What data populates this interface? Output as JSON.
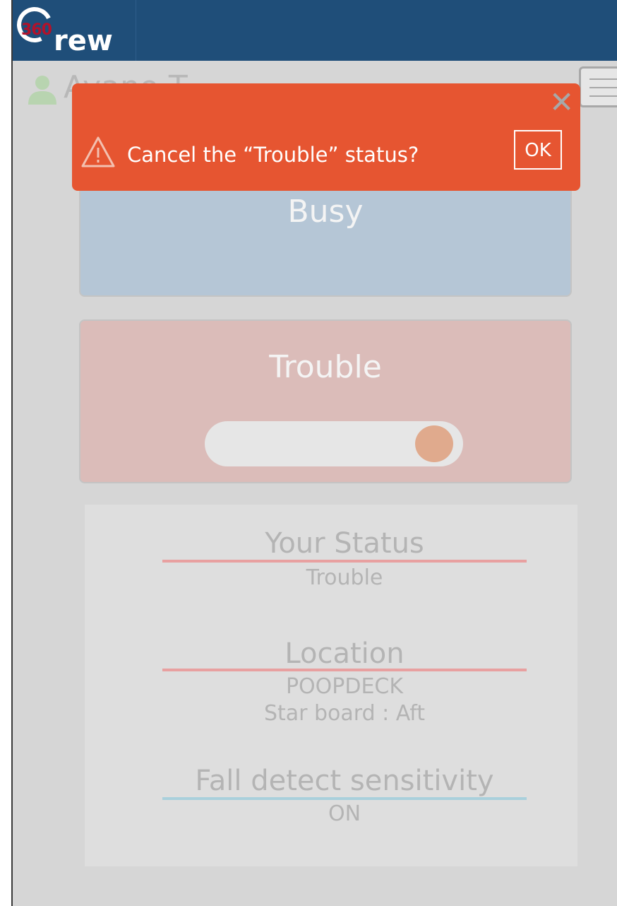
{
  "header": {
    "logo_number": "360",
    "logo_word": "rew"
  },
  "user": {
    "name": "Ayano T",
    "menu_icon": "hamburger-menu-icon"
  },
  "status_cards": {
    "busy": {
      "label": "Busy"
    },
    "trouble": {
      "label": "Trouble",
      "toggle_on": true
    }
  },
  "info": {
    "status": {
      "label": "Your Status",
      "value": "Trouble",
      "accent": "#e8a0a0"
    },
    "location": {
      "label": "Location",
      "value_line1": "POOPDECK",
      "value_line2": "Star board : Aft",
      "accent": "#e8a0a0"
    },
    "fall_detect": {
      "label": "Fall detect sensitivity",
      "value": "ON",
      "accent": "#a9d0dc"
    }
  },
  "alert": {
    "icon": "warning-triangle-icon",
    "message": "Cancel the “Trouble” status?",
    "ok_label": "OK",
    "close_icon": "close-icon",
    "color": "#e65531"
  }
}
